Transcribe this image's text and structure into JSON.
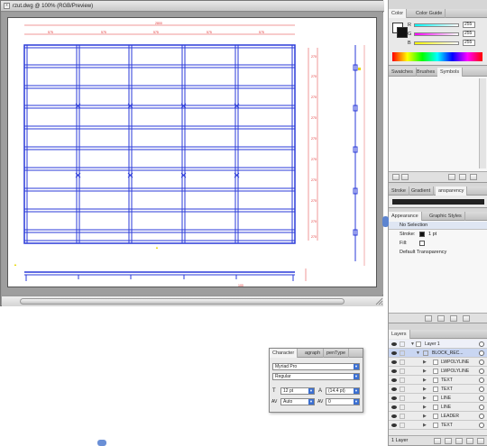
{
  "document": {
    "title": "rzut.dwg @ 100% (RGB/Preview)",
    "close_glyph": "x",
    "overall_dim": "2800",
    "top_dims": [
      "575",
      "575",
      "575",
      "575",
      "575"
    ],
    "right_dims": [
      "270",
      "270",
      "270",
      "270",
      "270",
      "270",
      "270",
      "270",
      "270",
      "270"
    ],
    "bottom_dim": "100",
    "scroll_glyph": "="
  },
  "panels": {
    "color": {
      "tabs": [
        "Color",
        "Color Guide"
      ],
      "channels": [
        {
          "label": "R",
          "value": "255"
        },
        {
          "label": "G",
          "value": "255"
        },
        {
          "label": "B",
          "value": "255"
        }
      ]
    },
    "swatches": {
      "tabs": [
        "Swatches",
        "Brushes",
        "Symbols"
      ]
    },
    "stroke": {
      "tabs": [
        "Stroke",
        "Gradient",
        "ansparency"
      ]
    },
    "appearance": {
      "tabs": [
        "Appearance",
        "Graphic Styles"
      ],
      "selection": "No Selection",
      "stroke_label": "Stroke:",
      "stroke_value": "1 pt",
      "fill_label": "Fill:",
      "opacity": "Default Transparency"
    },
    "layers": {
      "tabs": [
        "Layers"
      ],
      "rows": [
        {
          "label": "Layer 1",
          "depth": 0
        },
        {
          "label": "BLOCK_REC...",
          "depth": 1
        },
        {
          "label": "LWPOLYLINE",
          "depth": 2
        },
        {
          "label": "LWPOLYLINE",
          "depth": 2
        },
        {
          "label": "TEXT",
          "depth": 2
        },
        {
          "label": "TEXT",
          "depth": 2
        },
        {
          "label": "LINE",
          "depth": 2
        },
        {
          "label": "LINE",
          "depth": 2
        },
        {
          "label": "LEADER",
          "depth": 2
        },
        {
          "label": "TEXT",
          "depth": 2
        }
      ],
      "footer": "1 Layer"
    }
  },
  "character": {
    "tabs": [
      "Character",
      "agraph",
      "penType"
    ],
    "font_family": "Myriad Pro",
    "font_style": "Regular",
    "font_size": "12 pt",
    "leading": "(14.4 pt)",
    "kerning": "Auto",
    "tracking": "0"
  },
  "colors": {
    "drawing_blue": "#2a3ad8",
    "dim_red": "#e03030",
    "dim_yellow": "#e8d800",
    "selection_blue": "#3b6fd1"
  }
}
